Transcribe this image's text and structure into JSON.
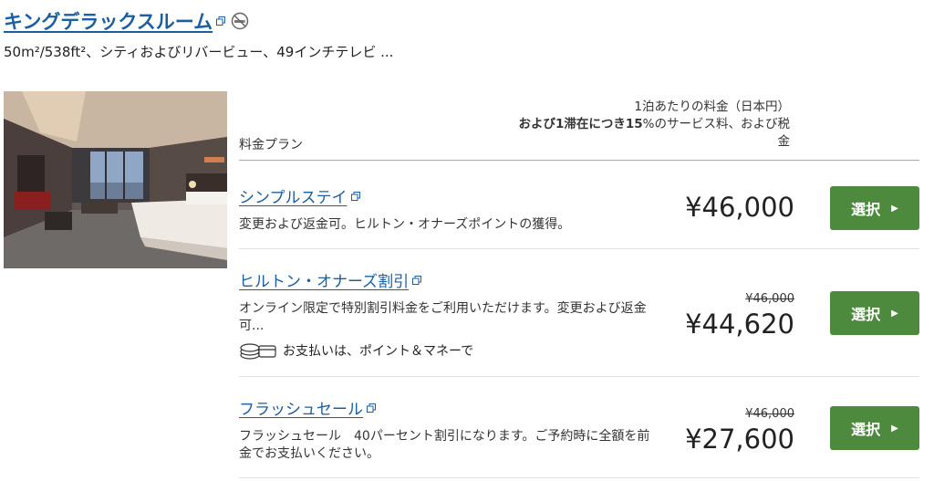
{
  "room": {
    "title": "キングデラックスルーム",
    "description": "50m²/538ft²、シティおよびリバービュー、49インチテレビ ..."
  },
  "table_header": {
    "plan_label": "料金プラン",
    "rate_line1": "1泊あたりの料金（日本円）",
    "rate_line2_bold": "および1滞在につき15",
    "rate_line2_rest": "%のサービス料、および税",
    "rate_line3": "金"
  },
  "plans": [
    {
      "name": "シンプルステイ",
      "description": "変更および返金可。ヒルトン・オナーズポイントの獲得。",
      "old_price": "",
      "price": "¥46,000",
      "button": "選択"
    },
    {
      "name": "ヒルトン・オナーズ割引",
      "description": "オンライン限定で特別割引料金をご利用いただけます。変更および返金可...",
      "payment_note": "お支払いは、ポイント＆マネーで",
      "old_price": "¥46,000",
      "price": "¥44,620",
      "button": "選択"
    },
    {
      "name": "フラッシュセール",
      "description": "フラッシュセール　40パーセント割引になります。ご予約時に全額を前金でお支払いください。",
      "old_price": "¥46,000",
      "price": "¥27,600",
      "button": "選択"
    }
  ],
  "colors": {
    "link": "#1b5fa0",
    "button": "#4d8a3e"
  },
  "icons": [
    "external-link-icon",
    "no-smoking-icon",
    "points-and-money-icon",
    "triangle-right-icon"
  ]
}
